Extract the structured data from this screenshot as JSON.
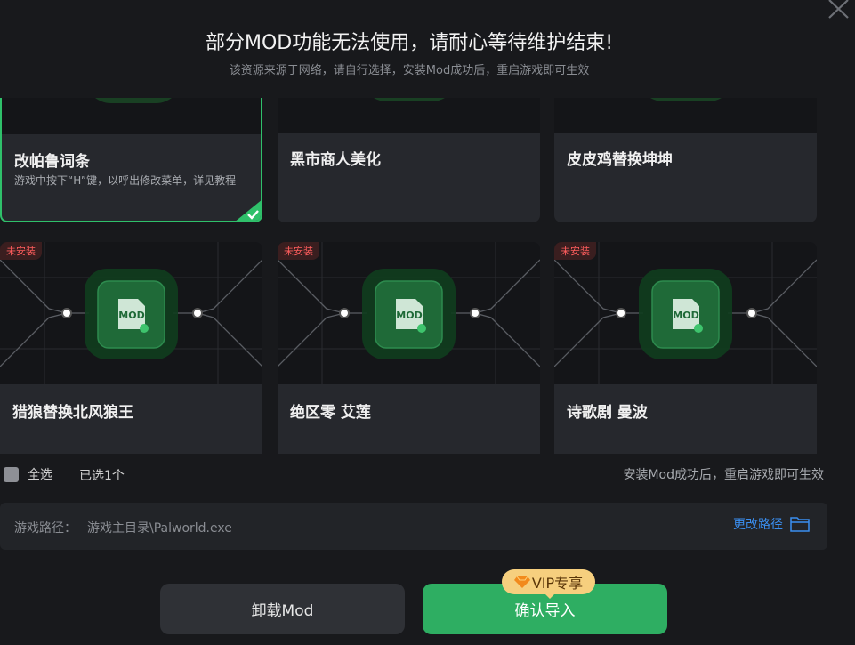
{
  "header": {
    "title": "部分MOD功能无法使用，请耐心等待维护结束!",
    "subtitle": "该资源来源于网络，请自行选择，安装Mod成功后，重启游戏即可生效"
  },
  "cards_row1": [
    {
      "title": "改帕鲁词条",
      "desc": "游戏中按下“H”键，以呼出修改菜单，详见教程",
      "selected": true
    },
    {
      "title": "黑市商人美化",
      "desc": "",
      "selected": false
    },
    {
      "title": "皮皮鸡替换坤坤",
      "desc": "",
      "selected": false
    }
  ],
  "cards_row2": [
    {
      "title": "猎狼替换北风狼王",
      "badge": "未安装",
      "icon_text": "MOD"
    },
    {
      "title": "绝区零 艾莲",
      "badge": "未安装",
      "icon_text": "MOD"
    },
    {
      "title": "诗歌剧 曼波",
      "badge": "未安装",
      "icon_text": "MOD"
    }
  ],
  "footer": {
    "select_all": "全选",
    "selected_count": "已选1个",
    "hint": "安装Mod成功后，重启游戏即可生效"
  },
  "path": {
    "label": "游戏路径：",
    "value": "游戏主目录\\Palworld.exe",
    "change_label": "更改路径"
  },
  "buttons": {
    "uninstall": "卸载Mod",
    "confirm": "确认导入",
    "vip": "VIP专享"
  },
  "colors": {
    "accent_green": "#2eae62",
    "link_blue": "#3a8ef0",
    "badge_red": "#ff5d5d",
    "vip_gold": "#f6cf7e"
  },
  "icons": [
    "close-icon",
    "check-icon",
    "mod-file-icon",
    "folder-icon",
    "diamond-icon"
  ]
}
